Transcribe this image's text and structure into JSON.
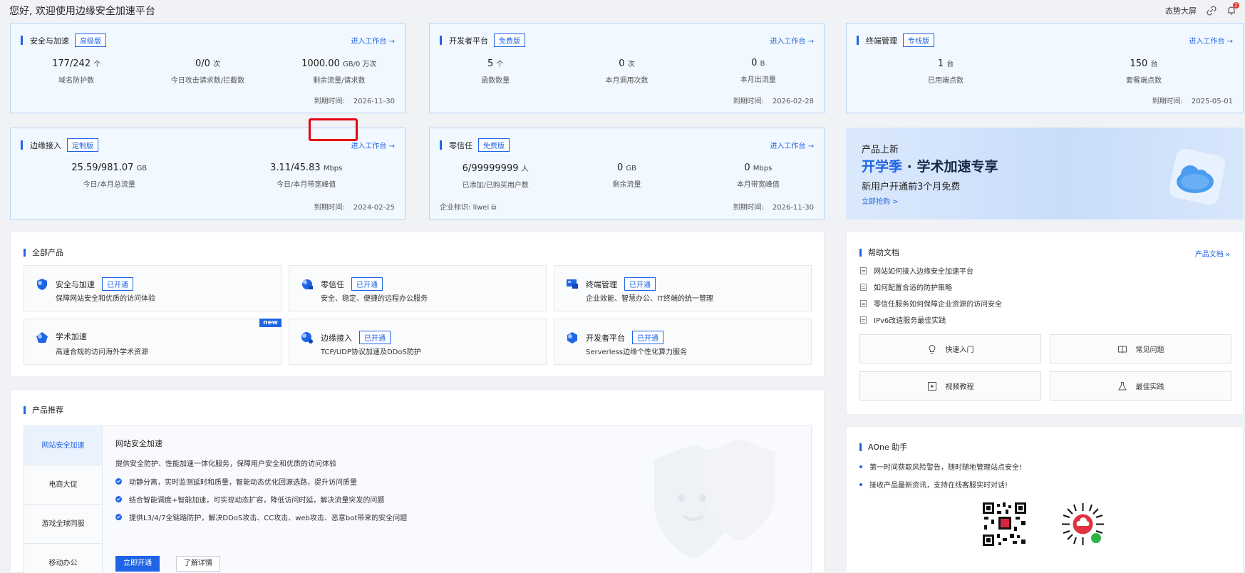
{
  "header": {
    "greeting": "您好, 欢迎使用边缘安全加速平台",
    "big_screen": "态势大屏",
    "notif_count": "2"
  },
  "cards": [
    {
      "title": "安全与加速",
      "tag": "高级版",
      "enter": "进入工作台 →",
      "stats": [
        {
          "value": "177/242",
          "unit": "个",
          "label": "域名防护数"
        },
        {
          "value": "0/0",
          "unit": "次",
          "label": "今日攻击请求数/拦截数"
        },
        {
          "value": "1000.00",
          "unit": "GB/0 万次",
          "label": "剩余流量/请求数"
        }
      ],
      "expire_label": "到期时间:",
      "expire": "2026-11-30"
    },
    {
      "title": "开发者平台",
      "tag": "免费版",
      "enter": "进入工作台 →",
      "stats": [
        {
          "value": "5",
          "unit": "个",
          "label": "函数数量"
        },
        {
          "value": "0",
          "unit": "次",
          "label": "本月调用次数"
        },
        {
          "value": "0",
          "unit": "B",
          "label": "本月出流量"
        }
      ],
      "expire_label": "到期时间:",
      "expire": "2026-02-28"
    },
    {
      "title": "终端管理",
      "tag": "专线版",
      "enter": "进入工作台 →",
      "stats": [
        {
          "value": "1",
          "unit": "台",
          "label": "已用端点数"
        },
        {
          "value": "150",
          "unit": "台",
          "label": "套餐端点数"
        }
      ],
      "expire_label": "到期时间:",
      "expire": "2025-05-01"
    },
    {
      "title": "边缘接入",
      "tag": "定制版",
      "enter": "进入工作台 →",
      "stats": [
        {
          "value": "25.59/981.07",
          "unit": "GB",
          "label": "今日/本月总流量"
        },
        {
          "value": "3.11/45.83",
          "unit": "Mbps",
          "label": "今日/本月带宽峰值"
        }
      ],
      "expire_label": "到期时间:",
      "expire": "2024-02-25"
    },
    {
      "title": "零信任",
      "tag": "免费版",
      "enter": "进入工作台 →",
      "stats": [
        {
          "value": "6/99999999",
          "unit": "人",
          "label": "已添加/已购买用户数"
        },
        {
          "value": "0",
          "unit": "GB",
          "label": "剩余流量"
        },
        {
          "value": "0",
          "unit": "Mbps",
          "label": "本月带宽峰值"
        }
      ],
      "enterprise_label": "企业标识:",
      "enterprise": "liwei",
      "expire_label": "到期时间:",
      "expire": "2026-11-30"
    }
  ],
  "banner": {
    "line1": "产品上新",
    "line2_highlight": "开学季",
    "line2_rest": " · 学术加速专享",
    "line3": "新用户开通前3个月免费",
    "cta": "立即抢购 >"
  },
  "all_products": {
    "title": "全部产品",
    "items": [
      {
        "name": "安全与加速",
        "tag": "已开通",
        "desc": "保障网站安全和优质的访问体验"
      },
      {
        "name": "零信任",
        "tag": "已开通",
        "desc": "安全、稳定、便捷的远程办公服务"
      },
      {
        "name": "终端管理",
        "tag": "已开通",
        "desc": "企业效能、智慧办公、IT终端的统一管理"
      },
      {
        "name": "学术加速",
        "tag": "",
        "badge": "new",
        "desc": "高速合规的访问海外学术资源"
      },
      {
        "name": "边缘接入",
        "tag": "已开通",
        "desc": "TCP/UDP协议加速及DDoS防护"
      },
      {
        "name": "开发者平台",
        "tag": "已开通",
        "desc": "Serverless边缘个性化算力服务"
      }
    ]
  },
  "help": {
    "title": "帮助文档",
    "link": "产品文档 »",
    "items": [
      "网站如何接入边缘安全加速平台",
      "如何配置合适的防护策略",
      "零信任服务如何保障企业资源的访问安全",
      "IPv6改造服务最佳实践"
    ],
    "buttons": [
      "快速入门",
      "常见问题",
      "视频教程",
      "最佳实践"
    ]
  },
  "recommend": {
    "title": "产品推荐",
    "tabs": [
      "网站安全加速",
      "电商大促",
      "游戏全球同服",
      "移动办公"
    ],
    "content_title": "网站安全加速",
    "content_desc": "提供安全防护、性能加速一体化服务，保障用户安全和优质的访问体验",
    "features": [
      "动静分离，实时监测延时和质量，智能动态优化回源选路，提升访问质量",
      "结合智能调度+智能加速，可实现动态扩容，降低访问时延，解决流量突发的问题",
      "提供L3/4/7全链路防护，解决DDoS攻击、CC攻击、web攻击、恶意bot带来的安全问题"
    ],
    "primary_btn": "立即开通",
    "secondary_btn": "了解详情"
  },
  "aone": {
    "title": "AOne 助手",
    "items": [
      "第一时间获取风险警告，随时随地管理站点安全!",
      "接收产品最新资讯，支持在线客服实时对话!"
    ]
  },
  "colors": {
    "primary": "#1f64e6",
    "highlight": "#e60012"
  }
}
